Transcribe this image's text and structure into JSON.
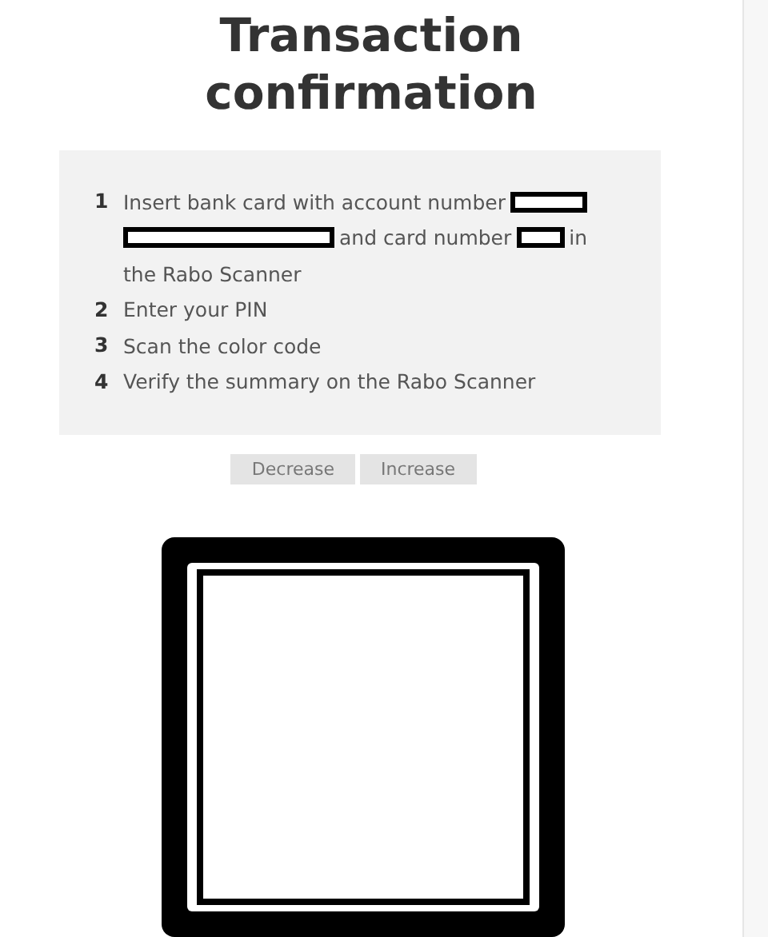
{
  "title": "Transaction confirmation",
  "steps": [
    {
      "number": "1",
      "lines": [
        [
          {
            "kind": "text",
            "text": "Insert bank card with account number"
          },
          {
            "kind": "redacted"
          }
        ],
        [
          {
            "kind": "redacted"
          },
          {
            "kind": "text",
            "text": "and card number"
          },
          {
            "kind": "redacted"
          },
          {
            "kind": "text",
            "text": "in"
          }
        ],
        [
          {
            "kind": "text",
            "text": "the Rabo Scanner"
          }
        ]
      ]
    },
    {
      "number": "2",
      "lines": [
        [
          {
            "kind": "text",
            "text": "Enter your PIN"
          }
        ]
      ]
    },
    {
      "number": "3",
      "lines": [
        [
          {
            "kind": "text",
            "text": "Scan the color code"
          }
        ]
      ]
    },
    {
      "number": "4",
      "lines": [
        [
          {
            "kind": "text",
            "text": "Verify the summary on the Rabo Scanner"
          }
        ]
      ]
    }
  ],
  "buttons": [
    "Decrease",
    "Increase"
  ]
}
